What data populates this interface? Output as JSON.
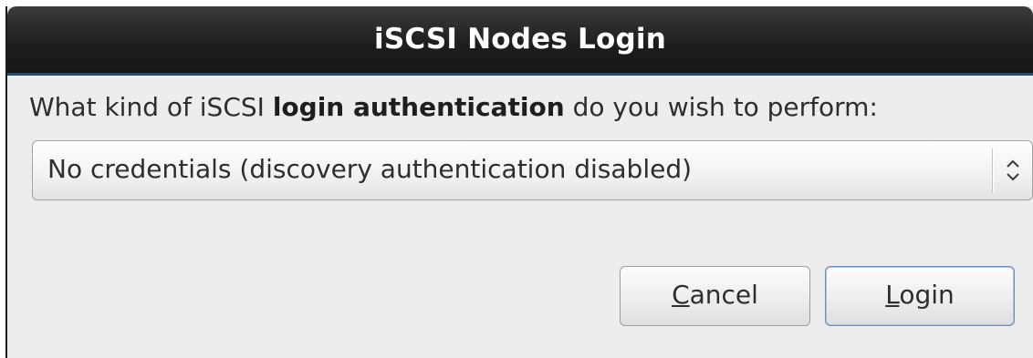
{
  "dialog": {
    "title": "iSCSI Nodes Login",
    "prompt_before": "What kind of iSCSI ",
    "prompt_bold": "login authentication",
    "prompt_after": " do you wish to perform:",
    "auth_select": {
      "selected": "No credentials (discovery authentication disabled)",
      "icon": "updown-chevrons-icon"
    },
    "buttons": {
      "cancel": {
        "mnemonic": "C",
        "rest": "ancel"
      },
      "login": {
        "mnemonic": "L",
        "rest": "ogin"
      }
    }
  },
  "colors": {
    "titlebar": "#1e1e1e",
    "background": "#ededed",
    "default_button_border": "#6d90b8"
  }
}
